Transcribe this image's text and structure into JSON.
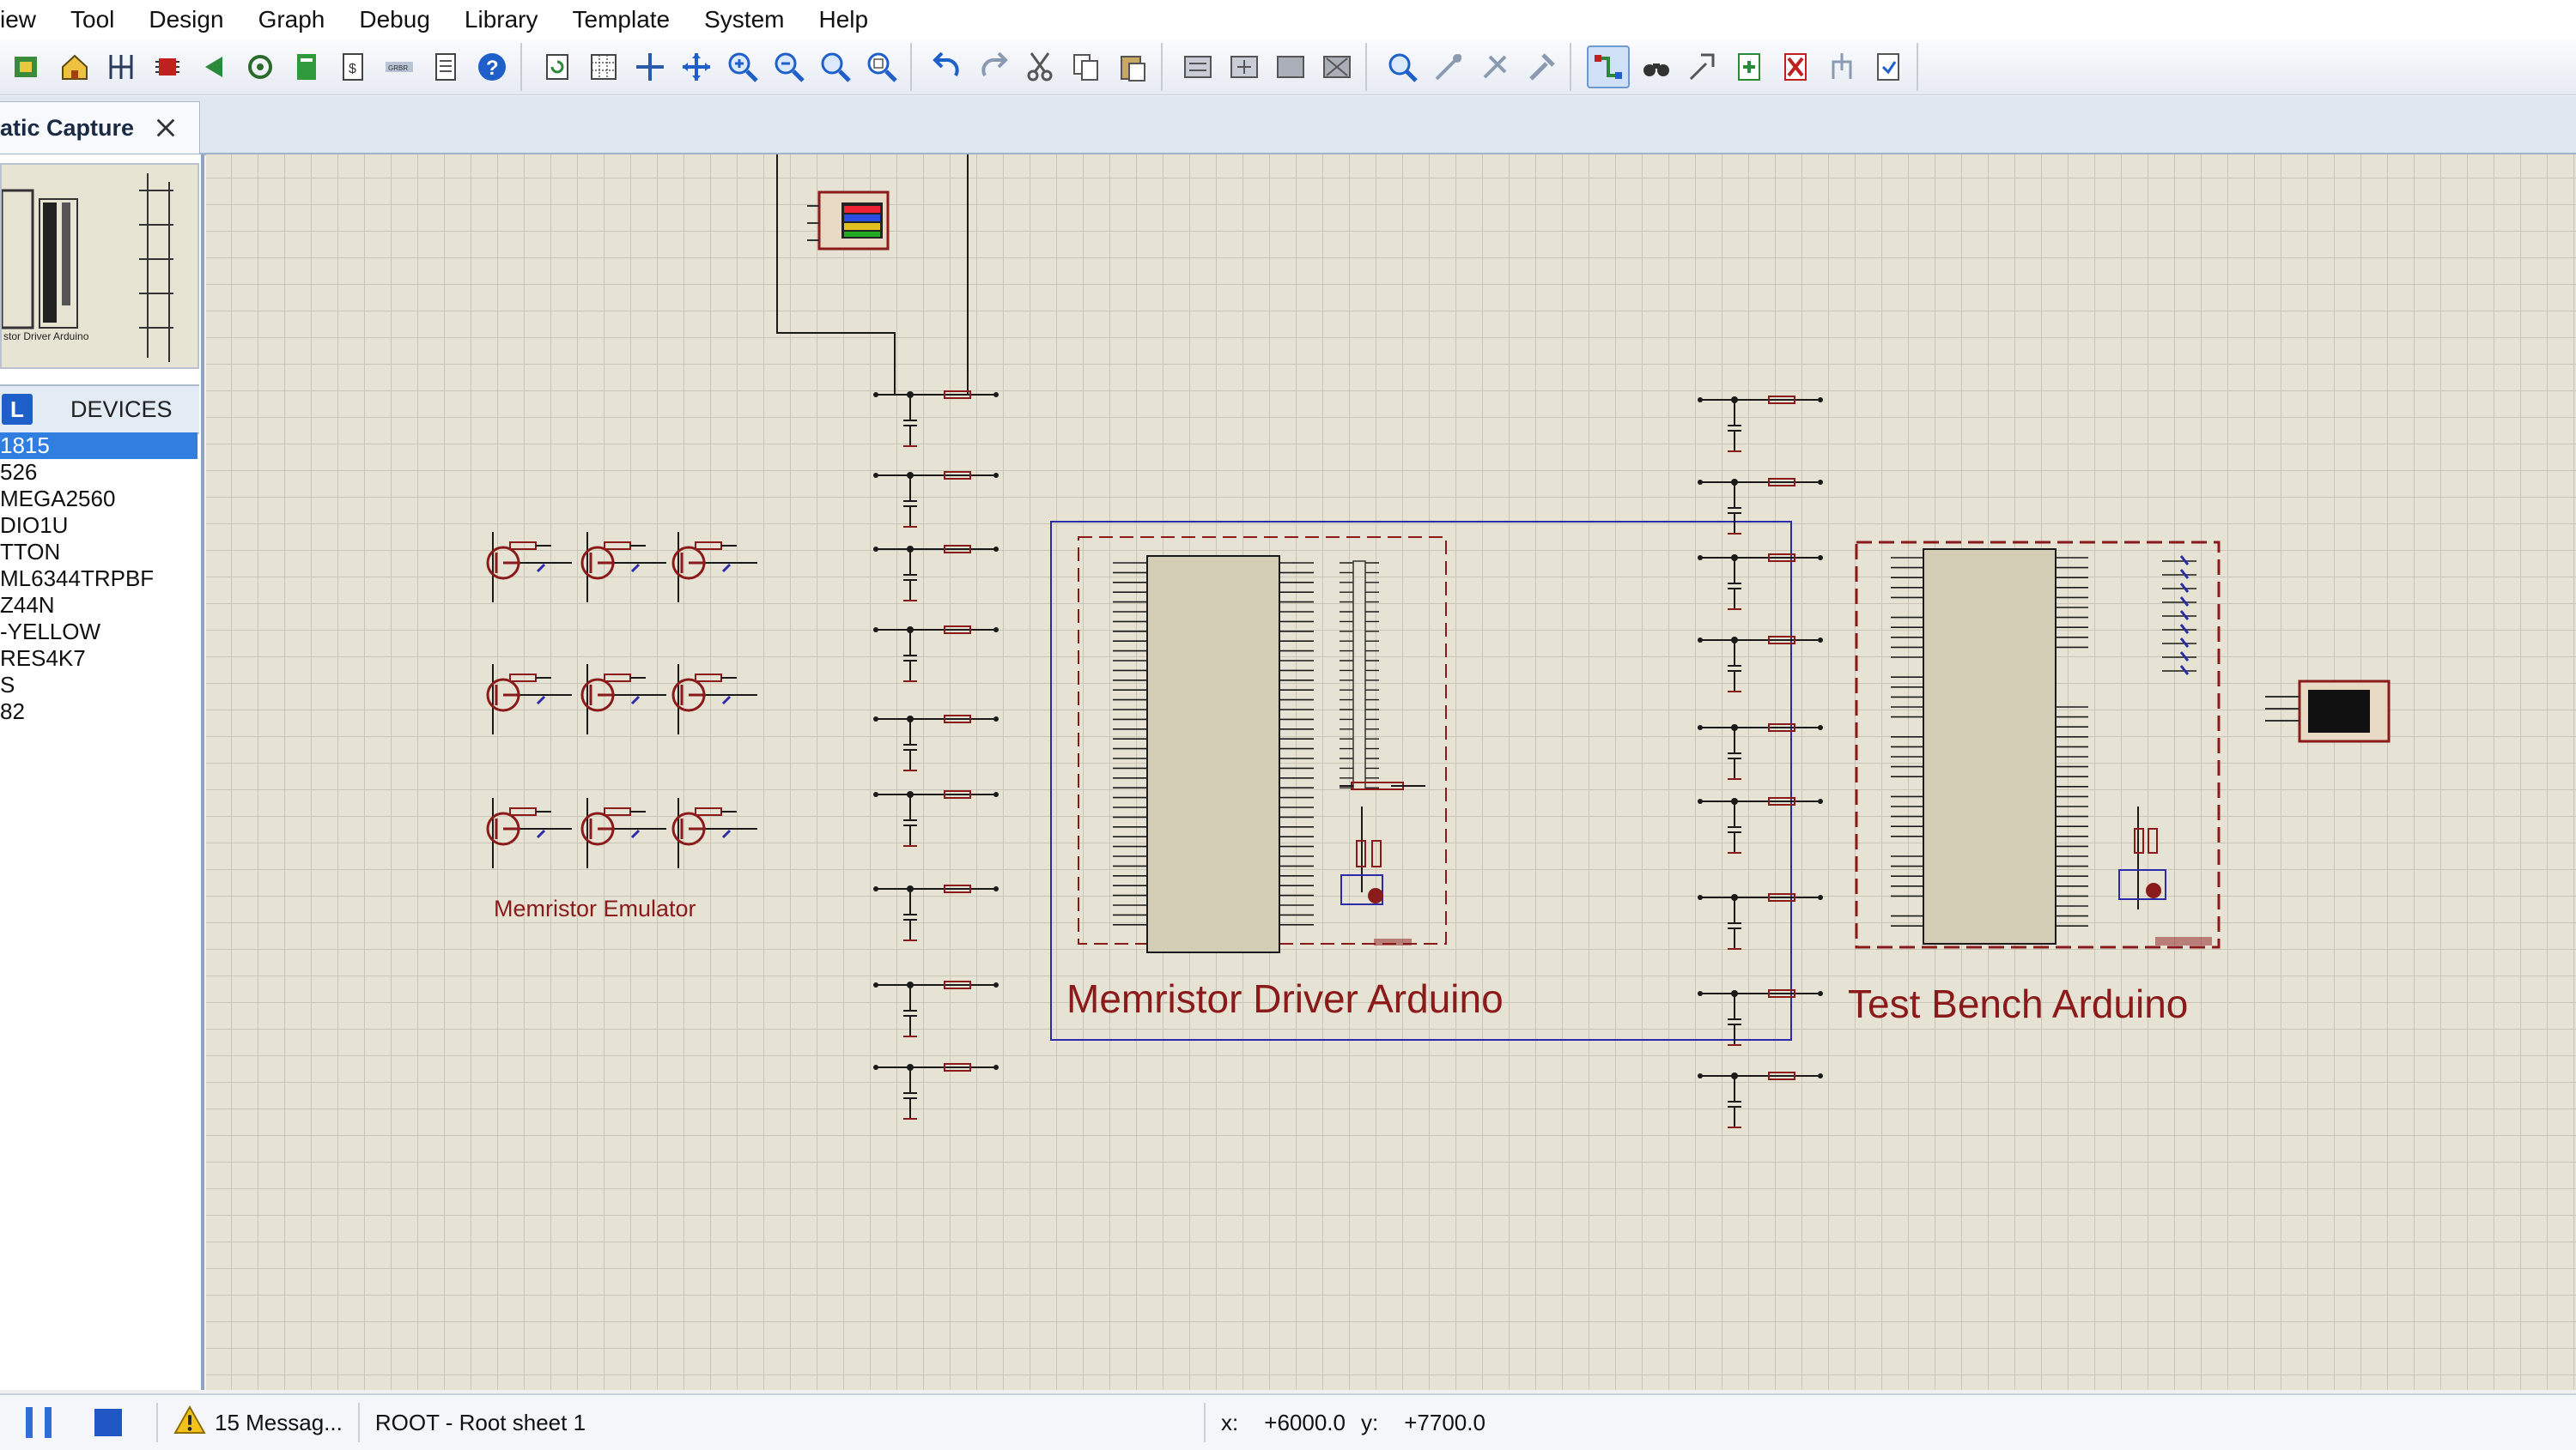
{
  "menu": [
    "iew",
    "Tool",
    "Design",
    "Graph",
    "Debug",
    "Library",
    "Template",
    "System",
    "Help"
  ],
  "tab": {
    "label": "atic Capture"
  },
  "devices_panel": {
    "picker_letter": "L",
    "title": "DEVICES",
    "items": [
      "1815",
      "526",
      "MEGA2560",
      "DIO1U",
      "TTON",
      "ML6344TRPBF",
      "Z44N",
      "-YELLOW",
      "RES4K7",
      "S",
      "82"
    ],
    "selected_index": 0
  },
  "overview": {
    "caption": "stor Driver Arduino"
  },
  "canvas": {
    "label_emulator": "Memristor Emulator",
    "label_driver": "Memristor Driver Arduino",
    "label_testbench": "Test Bench Arduino"
  },
  "status": {
    "messages": "15 Messag...",
    "sheet": "ROOT - Root sheet 1",
    "x_label": "x:",
    "x_value": "+6000.0",
    "y_label": "y:",
    "y_value": "+7700.0"
  },
  "colors": {
    "accent_blue": "#2f7ee0",
    "schematic_red": "#8b1a1a",
    "sheet_bg": "#e6e3d5",
    "selection_box": "#2c2ca8"
  }
}
